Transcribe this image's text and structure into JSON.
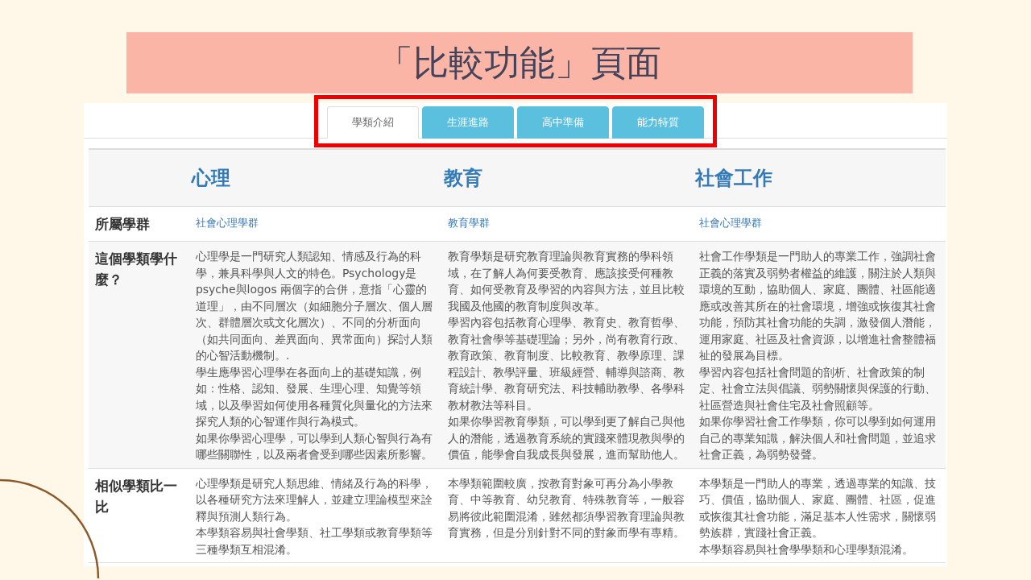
{
  "slide_title": "「比較功能」頁面",
  "tabs": [
    {
      "label": "學類介紹",
      "selected": true
    },
    {
      "label": "生涯進路",
      "selected": false
    },
    {
      "label": "高中準備",
      "selected": false
    },
    {
      "label": "能力特質",
      "selected": false
    }
  ],
  "table": {
    "columns": [
      "心理",
      "教育",
      "社會工作"
    ],
    "rows": [
      {
        "label": "所屬學群",
        "kind": "link",
        "cells": [
          [
            "社會心理學群"
          ],
          [
            "教育學群"
          ],
          [
            "社會心理學群"
          ]
        ]
      },
      {
        "label": "這個學類學什麼？",
        "kind": "text",
        "cells": [
          [
            "心理學是一門研究人類認知、情感及行為的科學，兼具科學與人文的特色。Psychology是psyche與logos 兩個字的合併，意指「心靈的道理」，由不同層次（如細胞分子層次、個人層次、群體層次或文化層次）、不同的分析面向（如共同面向、差異面向、異常面向）探討人類的心智活動機制。.",
            "學生應學習心理學在各面向上的基礎知識，例如：性格、認知、發展、生理心理、知覺等領域，以及學習如何使用各種質化與量化的方法來探究人類的心智運作與行為模式。",
            "如果你學習心理學，可以學到人類心智與行為有哪些關聯性，以及兩者會受到哪些因素所影響。"
          ],
          [
            "教育學類是研究教育理論與教育實務的學科領域，在了解人為何要受教育、應該接受何種教育、如何受教育及學習的內容與方法，並且比較我國及他國的教育制度與改革。",
            "學習內容包括教育心理學、教育史、教育哲學、教育社會學等基礎理論；另外，尚有教育行政、教育政策、教育制度、比較教育、教學原理、課程設計、教學評量、班級經營、輔導與諮商、教育統計學、教育研究法、科技輔助教學、各學科教材教法等科目。",
            "如果你學習教育學類，可以學到更了解自己與他人的潛能，透過教育系統的實踐來體現教與學的價值，能學會自我成長與發展，進而幫助他人。"
          ],
          [
            "社會工作學類是一門助人的專業工作，強調社會正義的落實及弱勢者權益的維護，關注於人類與環境的互動，協助個人、家庭、團體、社區能適應或改善其所在的社會環境，增強或恢復其社會功能，預防其社會功能的失調，激發個人潛能，運用家庭、社區及社會資源，以增進社會整體福祉的發展為目標。",
            "學習內容包括社會問題的剖析、社會政策的制定、社會立法與倡議、弱勢關懷與保護的行動、社區營造與社會住宅及社會照顧等。",
            "如果你學習社會工作學類，你可以學到如何運用自己的專業知識，解決個人和社會問題，並追求社會正義，為弱勢發聲。"
          ]
        ]
      },
      {
        "label": "相似學類比一比",
        "kind": "text",
        "cells": [
          [
            "心理學類是研究人類思維、情緒及行為的科學，以各種研究方法來理解人，並建立理論模型來詮釋與預測人類行為。",
            "本學類容易與社會學類、社工學類或教育學類等三種學類互相混淆。"
          ],
          [
            "本學類範圍較廣，按教育對象可再分為小學教育、中等教育、幼兒教育、特殊教育等，一般容易將彼此範圍混淆，雖然都須學習教育理論與教育實務，但是分別針對不同的對象而學有專精。"
          ],
          [
            "本學類是一門助人的專業，透過專業的知識、技巧、價值，協助個人、家庭、團體、社區，促進或恢復其社會功能，滿足基本人性需求，關懷弱勢族群，實踐社會正義。",
            "本學類容易與社會學學類和心理學類混淆。"
          ]
        ]
      }
    ]
  }
}
